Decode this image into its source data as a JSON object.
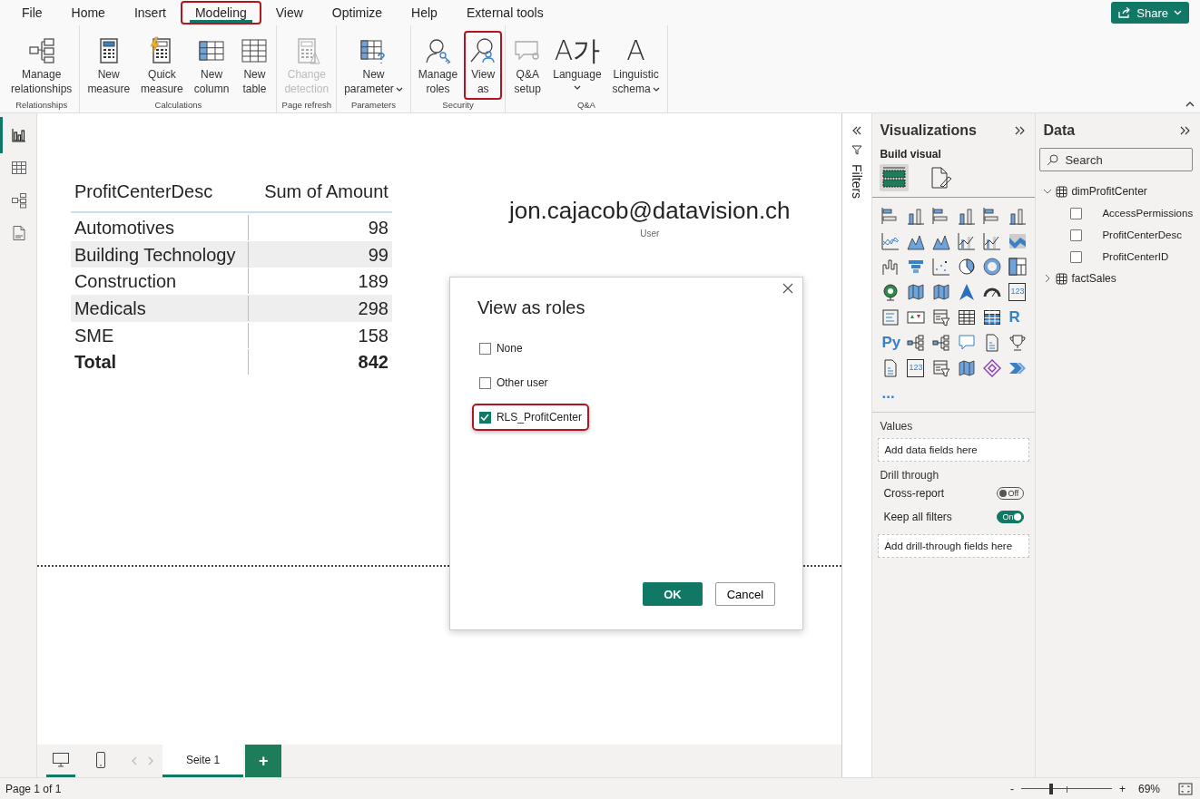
{
  "menu": {
    "tabs": [
      {
        "label": "File",
        "selected": false,
        "highlighted": false
      },
      {
        "label": "Home",
        "selected": false,
        "highlighted": false
      },
      {
        "label": "Insert",
        "selected": false,
        "highlighted": false
      },
      {
        "label": "Modeling",
        "selected": true,
        "highlighted": true
      },
      {
        "label": "View",
        "selected": false,
        "highlighted": false
      },
      {
        "label": "Optimize",
        "selected": false,
        "highlighted": false
      },
      {
        "label": "Help",
        "selected": false,
        "highlighted": false
      },
      {
        "label": "External tools",
        "selected": false,
        "highlighted": false
      }
    ],
    "share_button": "Share"
  },
  "ribbon": {
    "groups": [
      {
        "label": "Relationships",
        "buttons": [
          {
            "kind": "relationships",
            "lines": [
              "Manage",
              "relationships"
            ],
            "disabled": false,
            "highlighted": false,
            "dropdown": false
          }
        ]
      },
      {
        "label": "Calculations",
        "buttons": [
          {
            "kind": "calculator",
            "lines": [
              "New",
              "measure"
            ],
            "disabled": false,
            "highlighted": false,
            "dropdown": false
          },
          {
            "kind": "quick-measure",
            "lines": [
              "Quick",
              "measure"
            ],
            "disabled": false,
            "highlighted": false,
            "dropdown": false
          },
          {
            "kind": "column",
            "lines": [
              "New",
              "column"
            ],
            "disabled": false,
            "highlighted": false,
            "dropdown": false
          },
          {
            "kind": "table",
            "lines": [
              "New",
              "table"
            ],
            "disabled": false,
            "highlighted": false,
            "dropdown": false
          }
        ]
      },
      {
        "label": "Page refresh",
        "buttons": [
          {
            "kind": "change-detection",
            "lines": [
              "Change",
              "detection"
            ],
            "disabled": true,
            "highlighted": false,
            "dropdown": false
          }
        ]
      },
      {
        "label": "Parameters",
        "buttons": [
          {
            "kind": "parameter",
            "lines": [
              "New",
              "parameter"
            ],
            "disabled": false,
            "highlighted": false,
            "dropdown": true
          }
        ]
      },
      {
        "label": "Security",
        "buttons": [
          {
            "kind": "manage-roles",
            "lines": [
              "Manage",
              "roles"
            ],
            "disabled": false,
            "highlighted": false,
            "dropdown": false
          },
          {
            "kind": "view-as",
            "lines": [
              "View",
              "as"
            ],
            "disabled": false,
            "highlighted": true,
            "dropdown": false
          }
        ]
      },
      {
        "label": "Q&A",
        "buttons": [
          {
            "kind": "qa",
            "lines": [
              "Q&A",
              "setup"
            ],
            "disabled": false,
            "highlighted": false,
            "dropdown": false
          },
          {
            "kind": "glyph",
            "glyph": "A가",
            "lines": [
              "Language"
            ],
            "disabled": false,
            "highlighted": false,
            "dropdown": true
          },
          {
            "kind": "glyph",
            "glyph": "A",
            "lines": [
              "Linguistic",
              "schema"
            ],
            "disabled": false,
            "highlighted": false,
            "dropdown": true
          }
        ]
      }
    ]
  },
  "left_nav": [
    {
      "kind": "report",
      "selected": true
    },
    {
      "kind": "table",
      "selected": false
    },
    {
      "kind": "model",
      "selected": false
    },
    {
      "kind": "dax",
      "selected": false
    }
  ],
  "canvas": {
    "table": {
      "columns": [
        "ProfitCenterDesc",
        "Sum of Amount"
      ],
      "rows": [
        [
          "Automotives",
          "98"
        ],
        [
          "Building Technology",
          "99"
        ],
        [
          "Construction",
          "189"
        ],
        [
          "Medicals",
          "298"
        ],
        [
          "SME",
          "158"
        ]
      ],
      "total": [
        "Total",
        "842"
      ]
    },
    "card": {
      "value": "jon.cajacob@datavision.ch",
      "label": "User"
    }
  },
  "dialog": {
    "title": "View as roles",
    "options": [
      {
        "label": "None",
        "checked": false,
        "highlighted": false
      },
      {
        "label": "Other user",
        "checked": false,
        "highlighted": false
      },
      {
        "label": "RLS_ProfitCenter",
        "checked": true,
        "highlighted": true
      }
    ],
    "ok": "OK",
    "cancel": "Cancel"
  },
  "filters_pane": {
    "title": "Filters"
  },
  "visualizations": {
    "title": "Visualizations",
    "subtitle": "Build visual",
    "modes": [
      {
        "kind": "build",
        "selected": true
      },
      {
        "kind": "format",
        "selected": false
      }
    ],
    "visual_types": [
      {
        "kind": "hbar"
      },
      {
        "kind": "vbar"
      },
      {
        "kind": "hbar"
      },
      {
        "kind": "vbar"
      },
      {
        "kind": "hbar"
      },
      {
        "kind": "vbar"
      },
      {
        "kind": "line"
      },
      {
        "kind": "area"
      },
      {
        "kind": "area"
      },
      {
        "kind": "combo"
      },
      {
        "kind": "combo"
      },
      {
        "kind": "ribbon"
      },
      {
        "kind": "waterfall"
      },
      {
        "kind": "funnel"
      },
      {
        "kind": "scatter"
      },
      {
        "kind": "pie"
      },
      {
        "kind": "donut"
      },
      {
        "kind": "treemap"
      },
      {
        "kind": "globe"
      },
      {
        "kind": "map"
      },
      {
        "kind": "map"
      },
      {
        "kind": "arrow"
      },
      {
        "kind": "gauge"
      },
      {
        "kind": "card",
        "label": "123"
      },
      {
        "kind": "list"
      },
      {
        "kind": "kpi"
      },
      {
        "kind": "slicer"
      },
      {
        "kind": "table"
      },
      {
        "kind": "matrix"
      },
      {
        "kind": "text",
        "label": "R"
      },
      {
        "kind": "text",
        "label": "Py"
      },
      {
        "kind": "tree"
      },
      {
        "kind": "tree"
      },
      {
        "kind": "bubble"
      },
      {
        "kind": "doc"
      },
      {
        "kind": "trophy"
      },
      {
        "kind": "doc"
      },
      {
        "kind": "card",
        "label": "123"
      },
      {
        "kind": "slicer"
      },
      {
        "kind": "map"
      },
      {
        "kind": "diamond"
      },
      {
        "kind": "chevron"
      },
      {
        "kind": "text",
        "label": "..."
      }
    ],
    "values": {
      "label": "Values",
      "placeholder": "Add data fields here"
    },
    "drill_through": {
      "label": "Drill through",
      "toggles": [
        {
          "label": "Cross-report",
          "on": false,
          "state_text": "Off"
        },
        {
          "label": "Keep all filters",
          "on": true,
          "state_text": "On"
        }
      ],
      "placeholder": "Add drill-through fields here"
    }
  },
  "data": {
    "title": "Data",
    "search": {
      "placeholder": "Search"
    },
    "tables": [
      {
        "name": "dimProfitCenter",
        "expanded": true,
        "children": [
          {
            "name": "AccessPermissions",
            "checked": false
          },
          {
            "name": "ProfitCenterDesc",
            "checked": false
          },
          {
            "name": "ProfitCenterID",
            "checked": false
          }
        ]
      },
      {
        "name": "factSales",
        "expanded": false
      }
    ]
  },
  "page_bar": {
    "views": [
      {
        "kind": "desktop",
        "selected": true
      },
      {
        "kind": "phone",
        "selected": false
      }
    ],
    "pages": [
      {
        "label": "Seite 1",
        "selected": true
      }
    ],
    "add_page": "+"
  },
  "status_bar": {
    "page_info": "Page 1 of 1",
    "zoom_out": "-",
    "zoom_in": "+",
    "zoom": {
      "level": 0.33
    },
    "zoom_text": "69%"
  }
}
